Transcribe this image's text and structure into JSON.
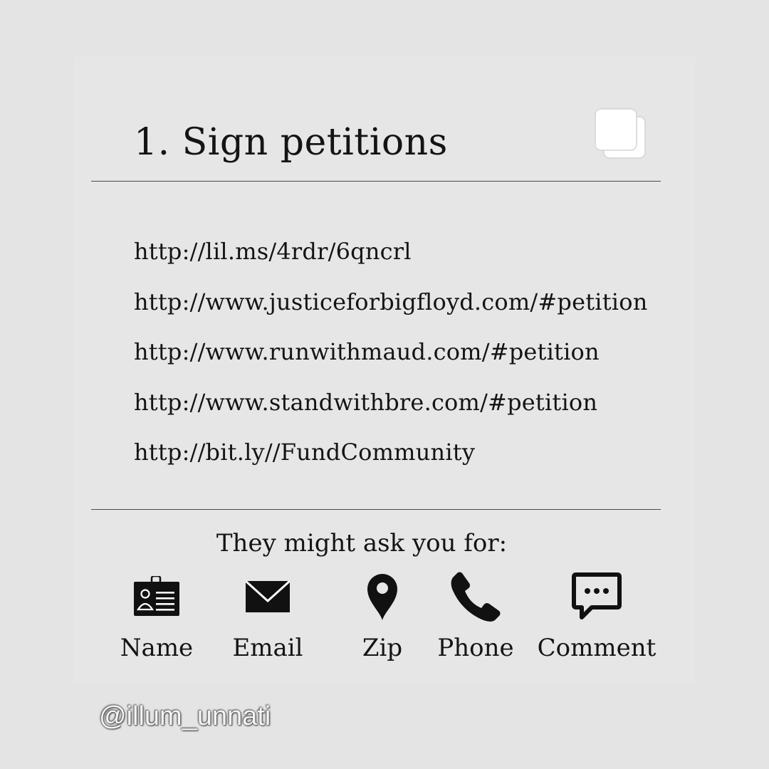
{
  "slide": {
    "title": "1. Sign petitions",
    "top_right_icon": "multiple-pages-icon"
  },
  "links": [
    "http://lil.ms/4rdr/6qncrl",
    "http://www.justiceforbigfloyd.com/#petition",
    "http://www.runwithmaud.com/#petition",
    "http://www.standwithbre.com/#petition",
    "http://bit.ly//FundCommunity"
  ],
  "ask": {
    "label": "They might ask you for:",
    "fields": [
      {
        "label": "Name",
        "icon": "id-badge-icon"
      },
      {
        "label": "Email",
        "icon": "envelope-icon"
      },
      {
        "label": "Zip",
        "icon": "map-pin-icon"
      },
      {
        "label": "Phone",
        "icon": "phone-icon"
      },
      {
        "label": "Comment",
        "icon": "speech-bubble-icon"
      }
    ]
  },
  "watermark": "@illum_unnati",
  "colors": {
    "background": "#e4e4e5",
    "text": "#141414",
    "rule": "#4a4a4a"
  }
}
